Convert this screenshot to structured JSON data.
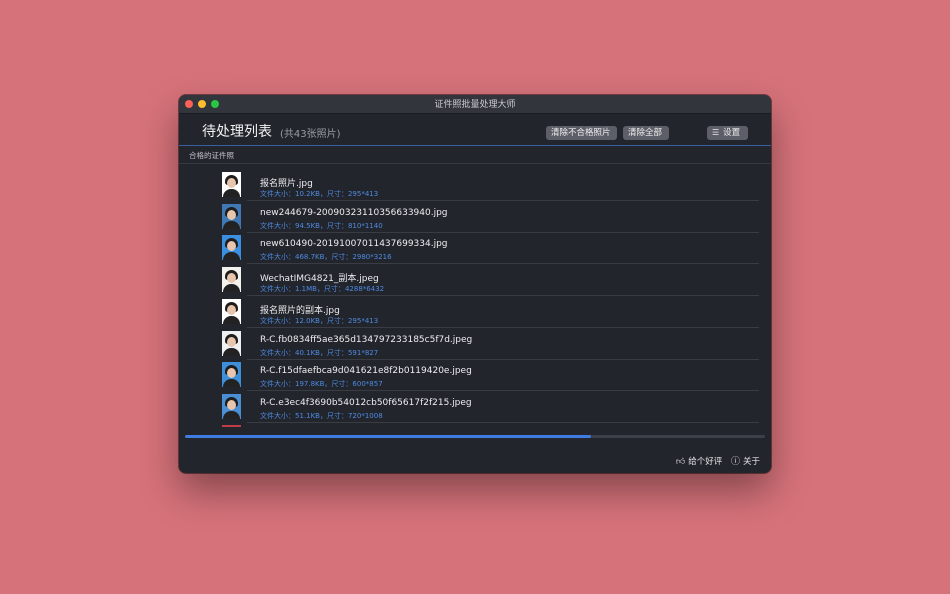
{
  "window": {
    "title": "证件照批量处理大师"
  },
  "header": {
    "title": "待处理列表",
    "count": "(共43张照片)",
    "clear_invalid_label": "清除不合格照片",
    "clear_all_label": "清除全部",
    "settings_label": "设置",
    "settings_icon": "sliders-icon"
  },
  "section": {
    "label": "合格的证件照"
  },
  "files": [
    {
      "name": "报名照片.jpg",
      "meta": "文件大小：10.2KB，尺寸：295*413",
      "bg": "#ffffff"
    },
    {
      "name": "new244679-20090323110356633940.jpg",
      "meta": "文件大小：94.5KB，尺寸：810*1140",
      "bg": "#3f78b5"
    },
    {
      "name": "new610490-20191007011437699334.jpg",
      "meta": "文件大小：468.7KB，尺寸：2980*3216",
      "bg": "#3b8fe0"
    },
    {
      "name": "WechatIMG4821_副本.jpeg",
      "meta": "文件大小：1.1MB，尺寸：4288*6432",
      "bg": "#f3f2ec"
    },
    {
      "name": "报名照片的副本.jpg",
      "meta": "文件大小：12.0KB，尺寸：295*413",
      "bg": "#ffffff"
    },
    {
      "name": "R-C.fb0834ff5ae365d134797233185c5f7d.jpeg",
      "meta": "文件大小：40.1KB，尺寸：591*827",
      "bg": "#eef0f2"
    },
    {
      "name": "R-C.f15dfaefbca9d041621e8f2b0119420e.jpeg",
      "meta": "文件大小：197.8KB，尺寸：600*857",
      "bg": "#3c8fd8"
    },
    {
      "name": "R-C.e3ec4f3690b54012cb50f65617f2f215.jpeg",
      "meta": "文件大小：51.1KB，尺寸：720*1008",
      "bg": "#4a8ed6"
    }
  ],
  "progress": {
    "value": 0.7
  },
  "footer": {
    "rate_label": "给个好评",
    "rate_icon": "thumbs-up-icon",
    "about_label": "关于",
    "about_icon": "question-circle-icon"
  }
}
